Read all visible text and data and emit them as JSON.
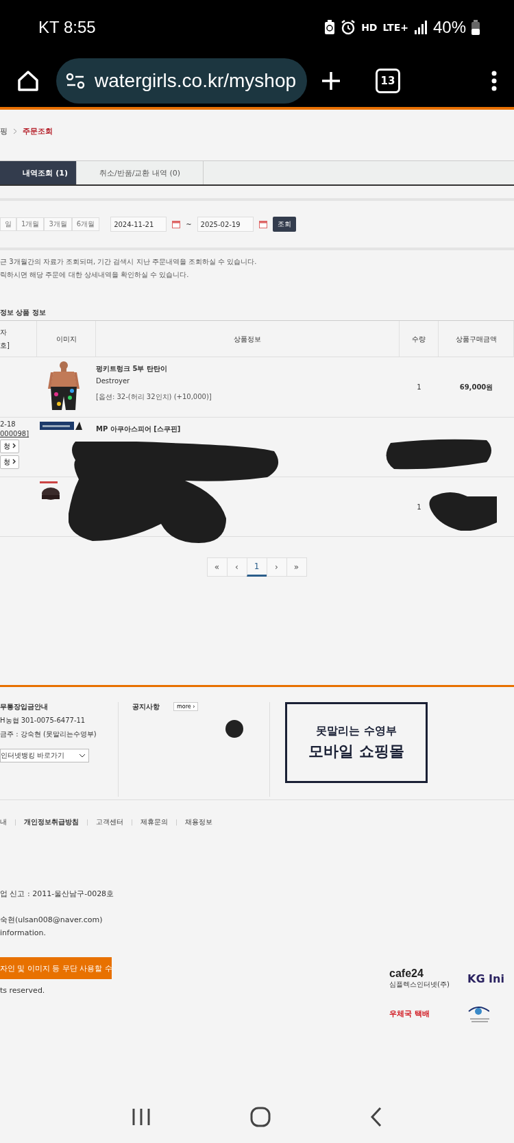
{
  "status_bar": {
    "carrier_time": "KT 8:55",
    "hd": "HD",
    "network": "LTE+",
    "battery": "40%"
  },
  "browser": {
    "url": "watergirls.co.kr/myshop",
    "tab_count": "13"
  },
  "breadcrumb": [
    {
      "label": "핑",
      "current": false
    },
    {
      "label": "주문조회",
      "current": true
    }
  ],
  "tabs": [
    {
      "label": "내역조회 (1)",
      "selected": true
    },
    {
      "label": "취소/반품/교환 내역 (0)",
      "selected": false
    }
  ],
  "period_buttons": [
    "일",
    "1개월",
    "3개월",
    "6개월"
  ],
  "date_from": "2024-11-21",
  "range_separator": "~",
  "date_to": "2025-02-19",
  "search_button": "조회",
  "notes": [
    "근 3개월간의 자료가 조회되며, 기간 검색시 지난 주문내역을 조회하실 수 있습니다.",
    "릭하시면 해당 주문에 대한 상세내역을 확인하실 수 있습니다."
  ],
  "section_title": "정보 상품 정보",
  "table": {
    "columns": [
      {
        "lines": [
          "자",
          "호]"
        ]
      },
      {
        "lines": [
          "이미지"
        ]
      },
      {
        "lines": [
          "상품정보"
        ]
      },
      {
        "lines": [
          "수량"
        ]
      },
      {
        "lines": [
          "상품구매금액"
        ]
      }
    ],
    "rows": [
      {
        "order_date": "",
        "order_no": "",
        "buttons": [],
        "image": {
          "kind": "picture"
        },
        "name": "펑키트렁크 5부 탄탄이",
        "brand": "Destroyer",
        "option": "[옵션: 32-(허리 32인치) (+10,000)]",
        "qty": "1",
        "price": "69,000원"
      },
      {
        "order_date": "2-18",
        "order_no": "000098]",
        "buttons": [
          "청",
          "청"
        ],
        "image": {
          "kind": "picture"
        },
        "name": "MP 아쿠아스피어 [스쿠핀]",
        "brand": "",
        "option": "",
        "qty": "",
        "price": ""
      },
      {
        "order_date": "",
        "order_no": "",
        "buttons": [],
        "image": {
          "kind": "picture"
        },
        "name": "",
        "brand": "",
        "option": "",
        "qty": "1",
        "price": ""
      }
    ]
  },
  "pagination": [
    {
      "label": "«",
      "selected": false
    },
    {
      "label": "‹",
      "selected": false
    },
    {
      "label": "1",
      "selected": true
    },
    {
      "label": "›",
      "selected": false
    },
    {
      "label": "»",
      "selected": false
    }
  ],
  "footer": {
    "bank": {
      "title": "무통장입금안내",
      "lines": [
        "H농협 301-0075-6477-11",
        "금주 : 강숙현 (못말리는수영부)"
      ],
      "select": "인터넷뱅킹 바로가기"
    },
    "notice": {
      "title": "공지사항",
      "more": "more ›"
    },
    "banner": [
      "못말리는 수영부",
      "모바일 쇼핑몰"
    ],
    "links": [
      {
        "label": "내",
        "bold": false
      },
      {
        "label": "개인정보취급방침",
        "bold": true
      },
      {
        "label": "고객센터",
        "bold": false
      },
      {
        "label": "제휴문의",
        "bold": false
      },
      {
        "label": "채용정보",
        "bold": false
      }
    ],
    "info": [
      "업 신고 : 2011-울산남구-0028호",
      "숙현(ulsan008@naver.com)",
      "information."
    ],
    "orange_notice": "자인 및 이미지 등 무단 사용할 수",
    "copyright": "ts reserved.",
    "logos": {
      "cafe24": "cafe24",
      "cafe24_sub": "심플렉스인터넷(주)",
      "kg": "KG Ini",
      "post": "우체국 택배"
    }
  }
}
